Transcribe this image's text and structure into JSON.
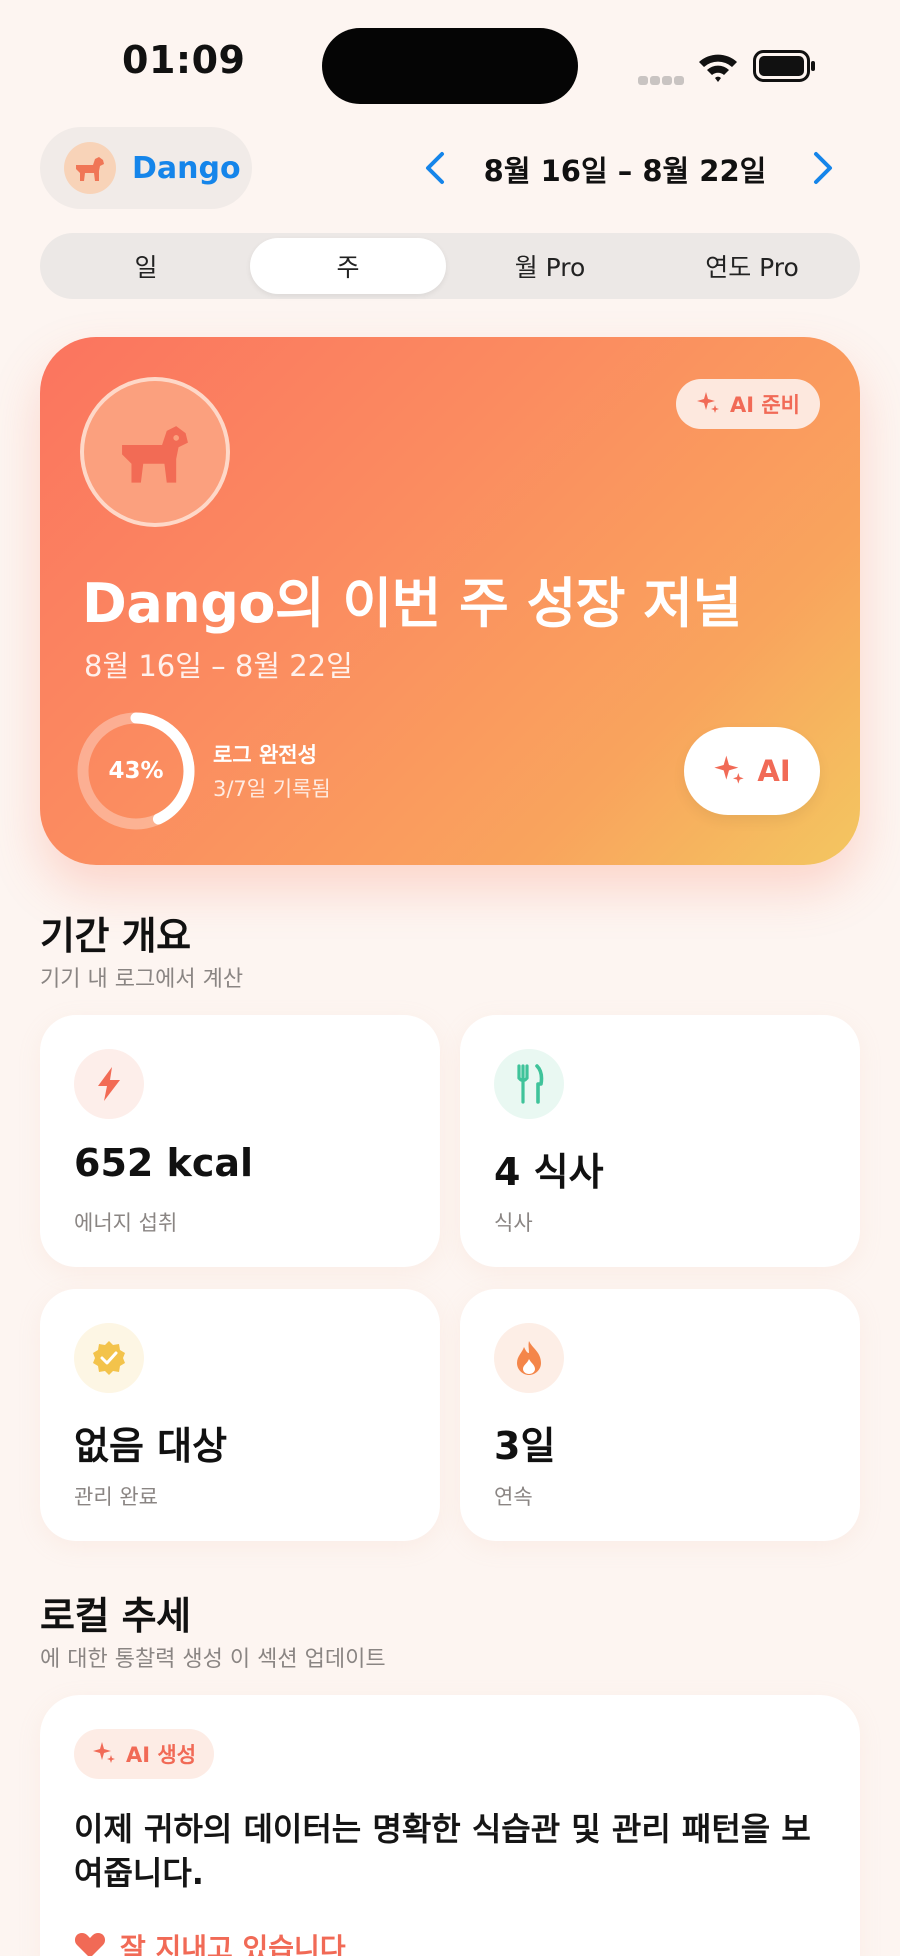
{
  "status_bar": {
    "time": "01:09"
  },
  "header": {
    "pet_name": "Dango",
    "date_range": "8월 16일 – 8월 22일"
  },
  "tabs": [
    {
      "label": "일",
      "active": false
    },
    {
      "label": "주",
      "active": true
    },
    {
      "label": "월 Pro",
      "active": false
    },
    {
      "label": "연도 Pro",
      "active": false
    }
  ],
  "hero": {
    "ai_badge": "AI 준비",
    "title": "Dango의 이번 주 성장 저널",
    "date_range": "8월 16일 – 8월 22일",
    "completeness_percent": "43%",
    "completeness_fraction": 0.43,
    "completeness_label": "로그 완전성",
    "completeness_detail": "3/7일 기록됨",
    "ai_button": "AI"
  },
  "overview": {
    "title": "기간 개요",
    "subtitle": "기기 내 로그에서 계산",
    "stats": [
      {
        "value": "652 kcal",
        "label": "에너지 섭취",
        "icon": "bolt-icon"
      },
      {
        "value": "4 식사",
        "label": "식사",
        "icon": "fork-knife-icon"
      },
      {
        "value": "없음 대상",
        "label": "관리 완료",
        "icon": "check-badge-icon"
      },
      {
        "value": "3일",
        "label": "연속",
        "icon": "flame-icon"
      }
    ]
  },
  "trend": {
    "title": "로컬 추세",
    "subtitle": "에 대한 통찰력 생성 이 섹션 업데이트",
    "ai_badge": "AI 생성",
    "insight": "이제 귀하의 데이터는 명확한 식습관 및 관리 패턴을 보여줍니다.",
    "status": "잘 지내고 있습니다"
  },
  "colors": {
    "accent_blue": "#1585ea",
    "accent_coral": "#f16a56",
    "background": "#fdf5f1"
  }
}
